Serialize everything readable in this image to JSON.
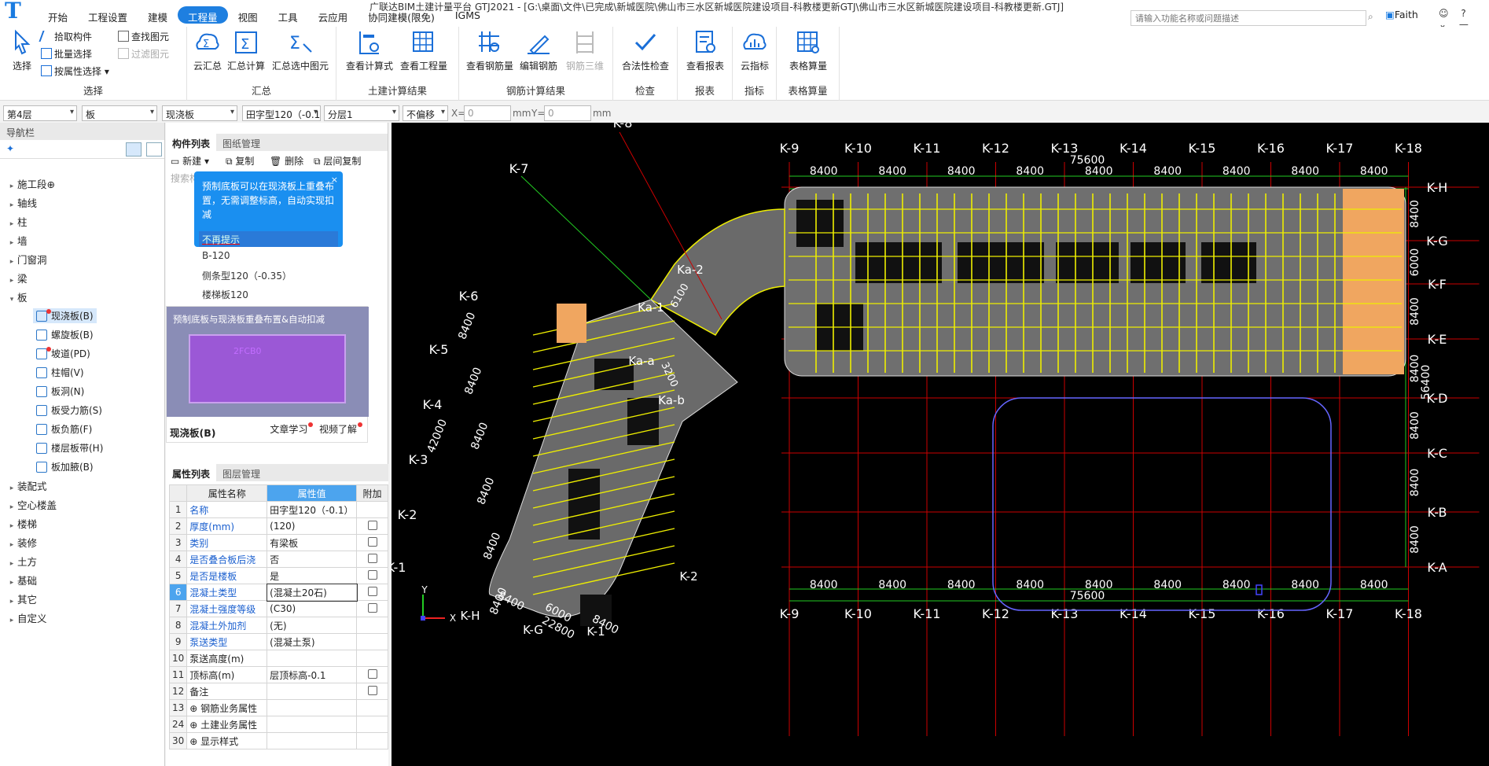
{
  "app": {
    "logo": "T",
    "title": "广联达BIM土建计量平台 GTJ2021 - [G:\\桌面\\文件\\已完成\\新城医院\\佛山市三水区新城医院建设项目-科教楼更新GTJ\\佛山市三水区新城医院建设项目-科教楼更新.GTJ]",
    "search_placeholder": "请输入功能名称或问题描述",
    "user": "Faith"
  },
  "tabs": [
    {
      "label": "开始"
    },
    {
      "label": "工程设置"
    },
    {
      "label": "建模"
    },
    {
      "label": "工程量",
      "active": true
    },
    {
      "label": "视图"
    },
    {
      "label": "工具"
    },
    {
      "label": "云应用"
    },
    {
      "label": "协同建模(限免)"
    },
    {
      "label": "IGMS"
    }
  ],
  "ribbon": {
    "select_group": {
      "label": "选择",
      "select": "选择",
      "pick": "拾取构件",
      "batch": "批量选择",
      "byattr": "按属性选择",
      "find": "查找图元",
      "filter": "过滤图元"
    },
    "sum_group": {
      "label": "汇总",
      "cloud": "云汇总",
      "calc": "汇总计算",
      "calc_sel": "汇总选中图元"
    },
    "civil_group": {
      "label": "土建计算结果",
      "formula": "查看计算式",
      "qty": "查看工程量"
    },
    "rebar_group": {
      "label": "钢筋计算结果",
      "view": "查看钢筋量",
      "edit": "编辑钢筋",
      "rebar3d": "钢筋三维"
    },
    "check_group": {
      "label": "检查",
      "legal": "合法性检查"
    },
    "report_group": {
      "label": "报表",
      "view": "查看报表"
    },
    "index_group": {
      "label": "指标",
      "cloud": "云指标"
    },
    "table_group": {
      "label": "表格算量",
      "calc": "表格算量"
    }
  },
  "toolbar": {
    "floor": "第4层",
    "type": "板",
    "sub": "现浇板",
    "comp": "田字型120（-0.1）",
    "layer": "分层1",
    "offset": "不偏移",
    "x_label": "X=",
    "x_val": "0",
    "unit1": "mm",
    "y_label": "Y=",
    "y_val": "0",
    "unit2": "mm"
  },
  "nav": {
    "title": "导航栏",
    "items": [
      {
        "label": "施工段",
        "lock": "⊕"
      },
      {
        "label": "轴线"
      },
      {
        "label": "柱"
      },
      {
        "label": "墙"
      },
      {
        "label": "门窗洞"
      },
      {
        "label": "梁"
      },
      {
        "label": "板",
        "open": true
      }
    ],
    "sub": [
      {
        "label": "现浇板(B)",
        "selected": true
      },
      {
        "label": "螺旋板(B)"
      },
      {
        "label": "坡道(PD)"
      },
      {
        "label": "柱帽(V)"
      },
      {
        "label": "板洞(N)"
      },
      {
        "label": "板受力筋(S)"
      },
      {
        "label": "板负筋(F)"
      },
      {
        "label": "楼层板带(H)"
      },
      {
        "label": "板加腋(B)"
      }
    ],
    "items2": [
      {
        "label": "装配式"
      },
      {
        "label": "空心楼盖"
      },
      {
        "label": "楼梯"
      },
      {
        "label": "装修"
      },
      {
        "label": "土方"
      },
      {
        "label": "基础"
      },
      {
        "label": "其它"
      },
      {
        "label": "自定义"
      }
    ]
  },
  "comp_panel": {
    "tab1": "构件列表",
    "tab2": "图纸管理",
    "new": "新建",
    "copy": "复制",
    "delete": "删除",
    "floor_copy": "层间复制",
    "search": "搜索构件",
    "tip": "预制底板可以在现浇板上重叠布置，无需调整标高，自动实现扣减",
    "tip_close": "×",
    "tip_no": "不再提示",
    "items": [
      "B-120",
      "侧条型120（-0.35）",
      "楼梯板120"
    ],
    "preview_caption": "预制底板与现浇板重叠布置&自动扣减",
    "preview_box": "2FCB0",
    "preview_title": "现浇板(B)",
    "article": "文章学习",
    "video": "视频了解"
  },
  "prop_panel": {
    "tab1": "属性列表",
    "tab2": "图层管理",
    "headers": [
      "属性名称",
      "属性值",
      "附加"
    ],
    "rows": [
      {
        "n": "1",
        "k": "名称",
        "v": "田字型120（-0.1）",
        "cb": false,
        "blue": true
      },
      {
        "n": "2",
        "k": "厚度(mm)",
        "v": "(120)",
        "cb": true,
        "blue": true
      },
      {
        "n": "3",
        "k": "类别",
        "v": "有梁板",
        "cb": true,
        "blue": true
      },
      {
        "n": "4",
        "k": "是否叠合板后浇",
        "v": "否",
        "cb": true,
        "blue": true
      },
      {
        "n": "5",
        "k": "是否是楼板",
        "v": "是",
        "cb": true,
        "blue": true
      },
      {
        "n": "6",
        "k": "混凝土类型",
        "v": "(混凝土20石)",
        "cb": true,
        "blue": true,
        "hl": true
      },
      {
        "n": "7",
        "k": "混凝土强度等级",
        "v": "(C30)",
        "cb": true,
        "blue": true
      },
      {
        "n": "8",
        "k": "混凝土外加剂",
        "v": "(无)",
        "cb": false,
        "blue": true
      },
      {
        "n": "9",
        "k": "泵送类型",
        "v": "(混凝土泵)",
        "cb": false,
        "blue": true
      },
      {
        "n": "10",
        "k": "泵送高度(m)",
        "v": "",
        "cb": false,
        "blue": false
      },
      {
        "n": "11",
        "k": "顶标高(m)",
        "v": "层顶标高-0.1",
        "cb": true,
        "blue": false
      },
      {
        "n": "12",
        "k": "备注",
        "v": "",
        "cb": true,
        "blue": false
      },
      {
        "n": "13",
        "k": "⊕ 钢筋业务属性",
        "v": "",
        "cb": false,
        "blue": false
      },
      {
        "n": "24",
        "k": "⊕ 土建业务属性",
        "v": "",
        "cb": false,
        "blue": false
      },
      {
        "n": "30",
        "k": "⊕ 显示样式",
        "v": "",
        "cb": false,
        "blue": false
      }
    ]
  },
  "drawing": {
    "top_axes": [
      "K-9",
      "K-10",
      "K-11",
      "K-12",
      "K-13",
      "K-14",
      "K-15",
      "K-16",
      "K-17",
      "K-18"
    ],
    "right_axes": [
      "K-H",
      "K-G",
      "K-F",
      "K-E",
      "K-D",
      "K-C",
      "K-B",
      "K-A"
    ],
    "curve_axes": [
      "K-8",
      "K-7",
      "K-6",
      "K-5",
      "K-4",
      "K-3",
      "K-2",
      "K-1"
    ],
    "bay": "8400",
    "total_h": "75600",
    "total_v": "56400",
    "right_dims": [
      "8400",
      "6000",
      "8400",
      "8400",
      "8400",
      "8400",
      "8400"
    ],
    "left_dims": [
      "8400",
      "8400",
      "8400",
      "8400",
      "8400",
      "8400"
    ],
    "left_total": "42000",
    "bottom_dims": [
      "8400",
      "6000",
      "8400"
    ],
    "bottom_total": "22800",
    "labels": {
      "ka2": "Ka-2",
      "ka1": "Ka-1",
      "ka": "Ka-a",
      "kb": "Ka-b",
      "kh": "K-H",
      "kg": "K-G",
      "k1b": "K-1",
      "k2b": "K-2",
      "ya": "6100",
      "yb": "3200"
    },
    "ucs_y": "Y",
    "ucs_x": "X"
  }
}
